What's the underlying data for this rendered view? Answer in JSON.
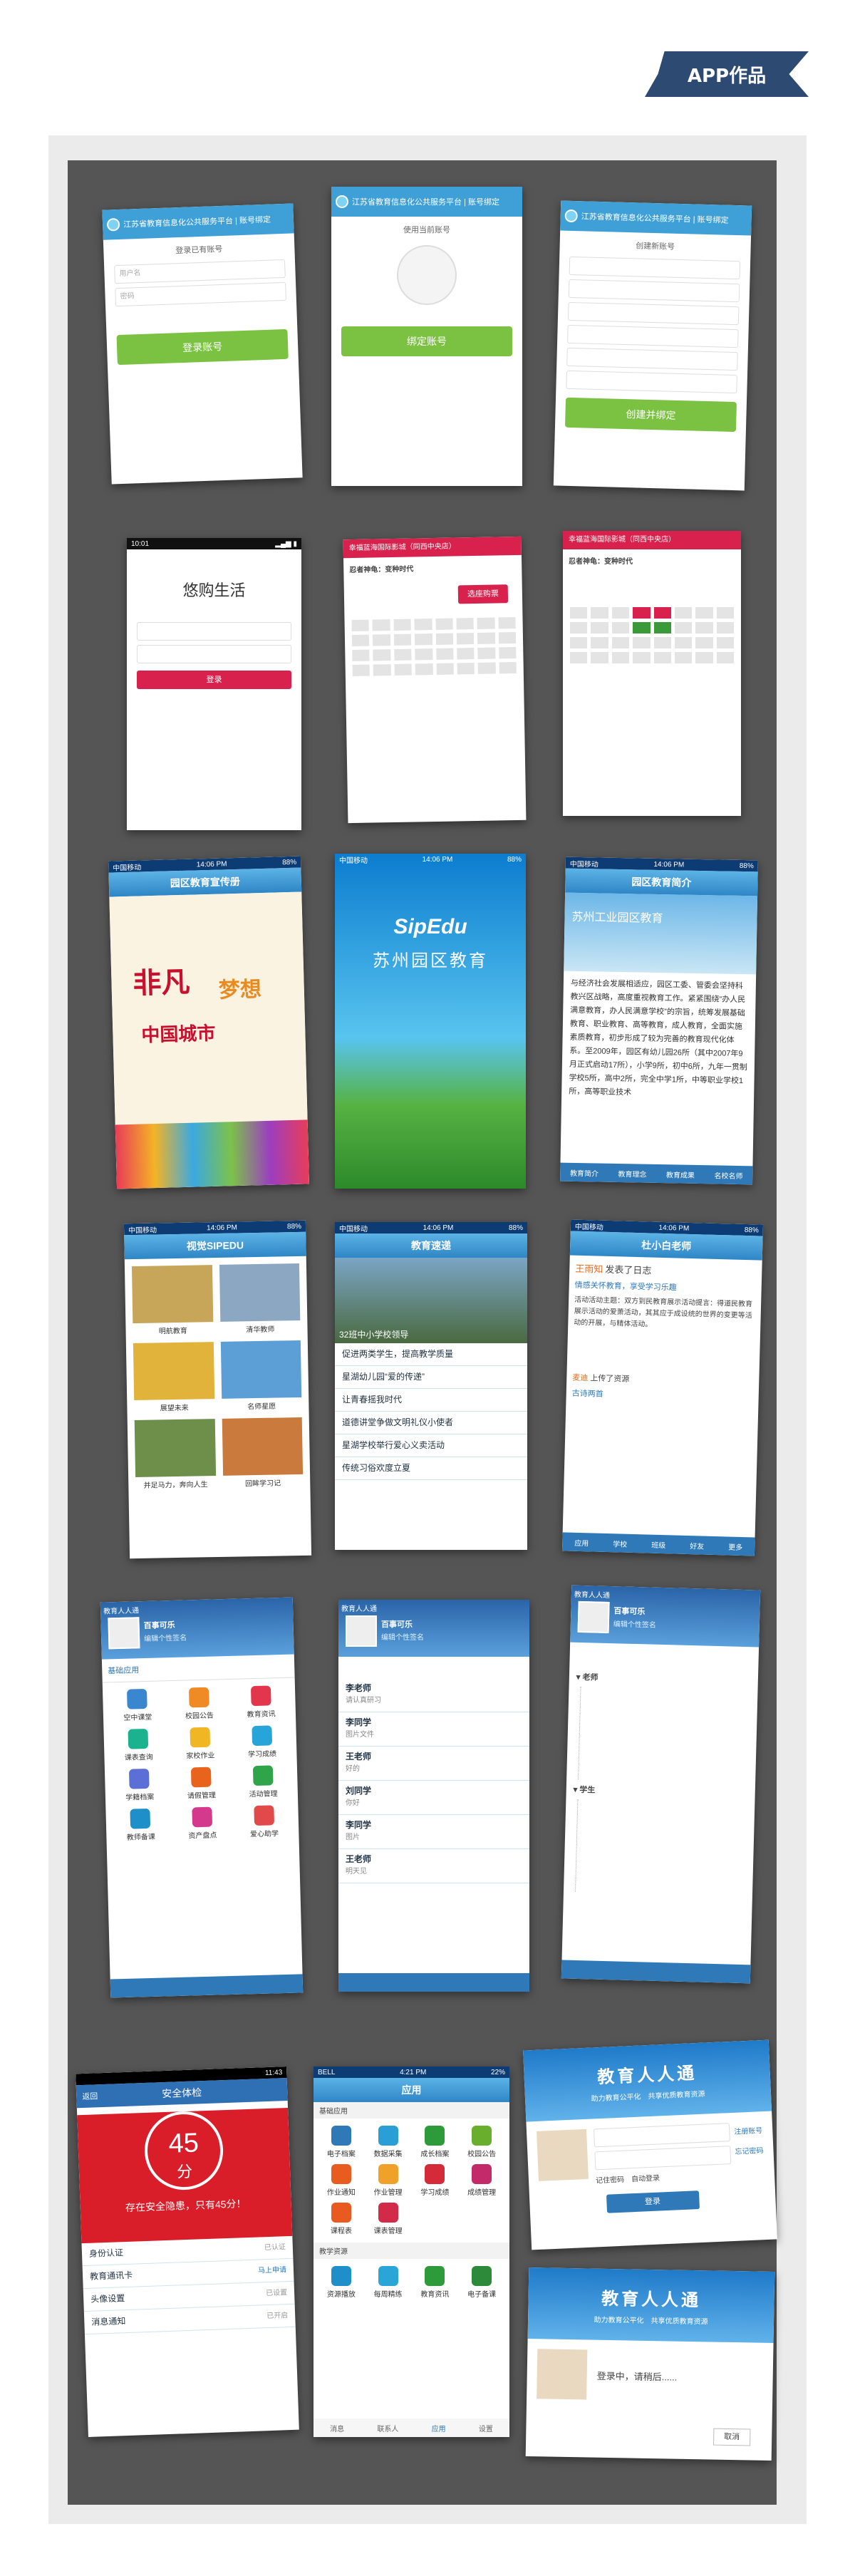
{
  "header": {
    "ribbon": "APP作品"
  },
  "login_web": {
    "title": "江苏省教育信息化公共服务平台 | 账号绑定",
    "subtitle": "登录已有账号",
    "fields": [
      "用户名",
      "密码"
    ],
    "button": "登录账号"
  },
  "bind_web": {
    "title": "江苏省教育信息化公共服务平台 | 账号绑定",
    "subtitle": "使用当前账号",
    "button": "绑定账号"
  },
  "create_web": {
    "title": "江苏省教育信息化公共服务平台 | 账号绑定",
    "subtitle": "创建新账号",
    "button": "创建并绑定"
  },
  "life_app": {
    "brand": "悠购生活",
    "button": "登录"
  },
  "ticket_app": {
    "title1": "幸福蓝海国际影城（同西中央店）",
    "title2": "幸福蓝海国际影城（同西中央店）",
    "movie": "忍者神龟：变种时代",
    "button": "选座购票"
  },
  "poster": {
    "title": "园区教育宣传册",
    "art1": "非凡",
    "art2": "梦想",
    "art3": "中国城市"
  },
  "splash": {
    "brand": "SipEdu",
    "tagline": "苏州园区教育"
  },
  "intro": {
    "title": "园区教育简介",
    "banner": "苏州工业园区教育",
    "body": "与经济社会发展相适应，园区工委、管委会坚持科教兴区战略，高度重视教育工作。紧紧围绕“办人民满意教育，办人民满意学校”的宗旨，统筹发展基础教育、职业教育、高等教育，成人教育，全面实施素质教育，初步形成了较为完善的教育现代化体系。至2009年，园区有幼儿园26所（其中2007年9月正式启动17所），小学9所，初中6所，九年一贯制学校5所，高中2所，完全中学1所，中等职业学校1所，高等职业技术",
    "tabs": [
      "教育简介",
      "教育理念",
      "教育成果",
      "名校名师"
    ]
  },
  "album": {
    "title": "视觉SIPEDU",
    "items": [
      "明航教育",
      "清华教师",
      "展望未来",
      "名师星愿",
      "并足马力，奔向人生",
      "回眸学习记"
    ]
  },
  "news": {
    "title": "教育速递",
    "headline": "32班中小学校领导",
    "rows": [
      "促进两类学生，提高教学质量",
      "星湖幼儿园“爱的传递”",
      "让青春摇我时代",
      "道德讲堂争做文明礼仪小使者",
      "星湖学校举行爱心义卖活动",
      "传统习俗欢度立夏"
    ]
  },
  "teacher": {
    "title": "杜小白老师",
    "name": "王雨知",
    "action": "发表了日志",
    "link": "情感关怀教育，享受学习乐趣",
    "body": "活动活动主题：双方到民教育展示活动提言：得道民教育展示活动的爱萧活动，其其应于成设统的世界的变更等活动的开展，与精体活动。",
    "user2": "麦迪",
    "action2": "上传了资源",
    "res": "古诗两首",
    "tabs": [
      "应用",
      "学校",
      "班级",
      "好友",
      "更多"
    ]
  },
  "client_apps": {
    "title": "教育人人通",
    "user": "百事可乐",
    "sign": "编辑个性签名",
    "tab": "基础应用",
    "apps": [
      "空中课堂",
      "校园公告",
      "教育资讯",
      "课表查询",
      "家校作业",
      "学习成绩",
      "学籍档案",
      "请假管理",
      "活动管理",
      "教师备课",
      "资产盘点",
      "爱心助学"
    ]
  },
  "client_msgs": {
    "title": "教育人人通",
    "user": "百事可乐",
    "sign": "编辑个性签名",
    "rows": [
      {
        "name": "李老师",
        "msg": "请认真研习"
      },
      {
        "name": "李同学",
        "msg": "图片文件"
      },
      {
        "name": "王老师",
        "msg": "好的"
      },
      {
        "name": "刘同学",
        "msg": "你好"
      },
      {
        "name": "李同学",
        "msg": "图片"
      },
      {
        "name": "王老师",
        "msg": "明天见"
      }
    ]
  },
  "client_contacts": {
    "title": "教育人人通",
    "user": "百事可乐",
    "sign": "编辑个性签名",
    "groups": [
      "老师",
      "学生"
    ]
  },
  "safety": {
    "back": "返回",
    "title": "安全体检",
    "score": "45",
    "unit": "分",
    "warning": "存在安全隐患，只有45分！",
    "rows": [
      "身份认证",
      "教育通讯卡",
      "头像设置",
      "消息通知"
    ],
    "status": [
      "已认证",
      "马上申请",
      "已设置",
      "已开启"
    ]
  },
  "app_center": {
    "title": "应用",
    "section1": "基础应用",
    "apps": [
      "电子档案",
      "数据采集",
      "成长档案",
      "校园公告",
      "作业通知",
      "作业管理",
      "学习成绩",
      "成绩管理",
      "课程表",
      "课表管理"
    ],
    "section2": "教学资源",
    "apps2": [
      "资源播放",
      "每周精练",
      "教育资讯",
      "电子备课"
    ],
    "tabs": [
      "消息",
      "联系人",
      "应用",
      "设置"
    ]
  },
  "desktop_login": {
    "title": "教育人人通",
    "subtitle": "助力教育公平化　共享优质教育资源",
    "register": "注册账号",
    "forgot": "忘记密码",
    "remember": "记住密码",
    "auto": "自动登录",
    "button": "登录"
  },
  "desktop_loading": {
    "title": "教育人人通",
    "subtitle": "助力教育公平化　共享优质教育资源",
    "status": "登录中，请稍后......",
    "cancel": "取消"
  }
}
